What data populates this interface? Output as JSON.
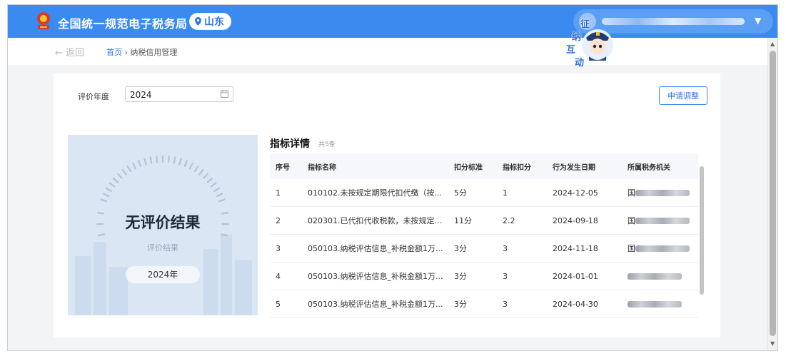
{
  "header": {
    "site_title": "全国统一规范电子税务局",
    "region": "山东",
    "user_name": "",
    "colors": {
      "primary": "#3a8af0",
      "region_text": "#2f78e4"
    }
  },
  "mascot": {
    "chars": [
      "征",
      "纳",
      "互",
      "动"
    ]
  },
  "nav": {
    "back_label": "← 返回",
    "breadcrumb_home": "首页",
    "breadcrumb_sep": "›",
    "breadcrumb_current": "纳税信用管理"
  },
  "filter": {
    "year_label": "评价年度",
    "year_value": "2024",
    "apply_button": "申请调整"
  },
  "result": {
    "main": "无评价结果",
    "sub": "评价结果",
    "year": "2024年"
  },
  "detail": {
    "title": "指标详情",
    "count": "共5条",
    "columns": [
      "序号",
      "指标名称",
      "扣分标准",
      "指标扣分",
      "行为发生日期",
      "所属税务机关"
    ],
    "rows": [
      {
        "no": "1",
        "name": "010102.未按规定期限代扣代缴（按...",
        "standard": "5分",
        "deduct": "1",
        "date": "2024-12-05",
        "org": "国"
      },
      {
        "no": "2",
        "name": "020301.已代扣代收税款，未按规定...",
        "standard": "11分",
        "deduct": "2.2",
        "date": "2024-09-18",
        "org": "国"
      },
      {
        "no": "3",
        "name": "050103.纳税评估信息_补税金额1万...",
        "standard": "3分",
        "deduct": "3",
        "date": "2024-11-18",
        "org": "国"
      },
      {
        "no": "4",
        "name": "050103.纳税评估信息_补税金额1万...",
        "standard": "3分",
        "deduct": "3",
        "date": "2024-01-01",
        "org": ""
      },
      {
        "no": "5",
        "name": "050103.纳税评估信息_补税金额1万...",
        "standard": "3分",
        "deduct": "3",
        "date": "2024-04-30",
        "org": ""
      }
    ]
  }
}
